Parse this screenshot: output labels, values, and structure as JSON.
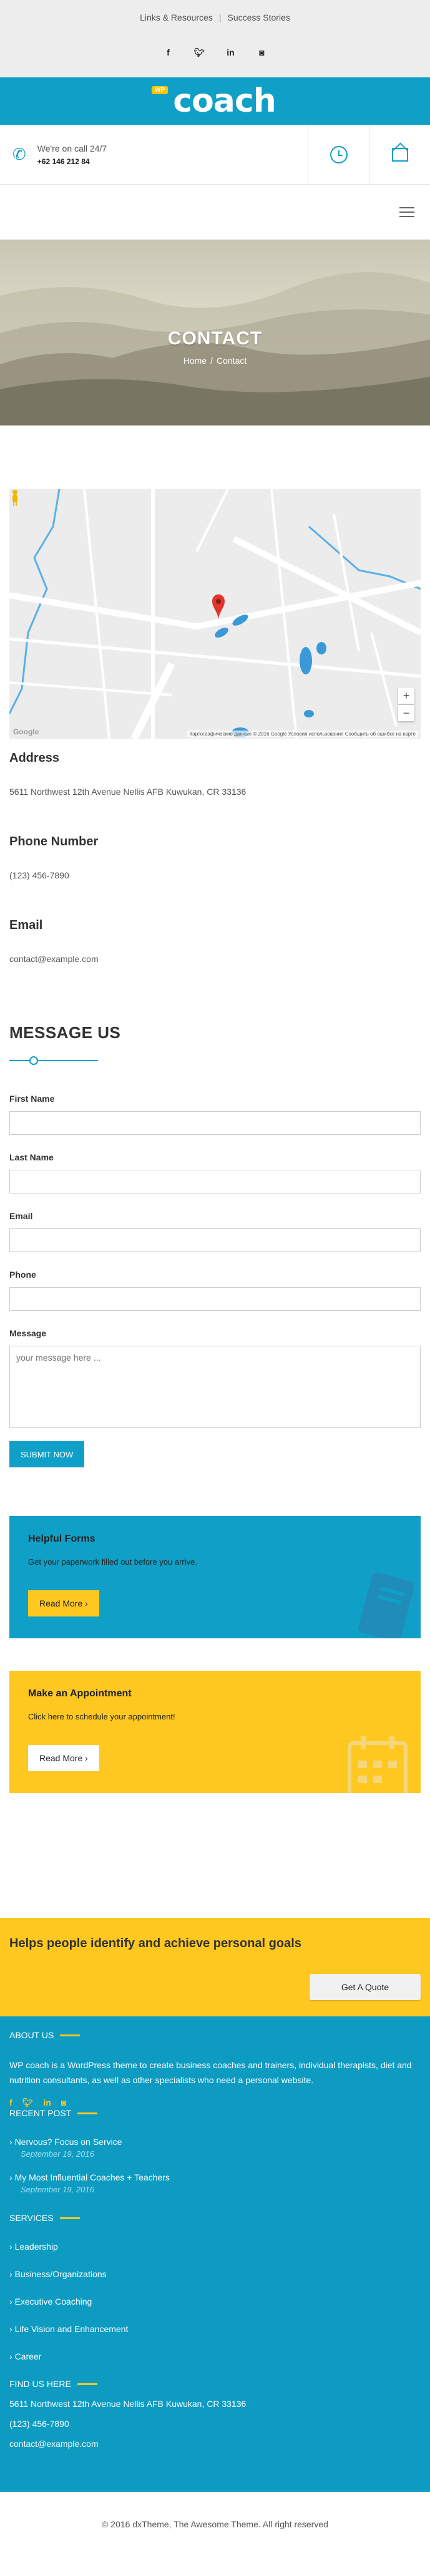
{
  "topbar": {
    "links": [
      "Links & Resources",
      "Success Stories"
    ],
    "social": [
      "f",
      "t",
      "in",
      "ig"
    ]
  },
  "logo": {
    "badge": "WP",
    "text": "coach"
  },
  "callbar": {
    "line1": "We're on call 24/7",
    "line2": "+62 146 212 84"
  },
  "hero": {
    "title": "CONTACT",
    "crumb_home": "Home",
    "crumb_sep": "/",
    "crumb_current": "Contact"
  },
  "map": {
    "google": "Google",
    "footer": "Картографические данные © 2016 Google    Условия использования    Сообщить об ошибке на карте",
    "zoom_in": "+",
    "zoom_out": "−"
  },
  "contact": {
    "address_label": "Address",
    "address": "5611 Northwest 12th Avenue Nellis AFB Kuwukan, CR 33136",
    "phone_label": "Phone Number",
    "phone": "(123) 456-7890",
    "email_label": "Email",
    "email": "contact@example.com"
  },
  "form": {
    "title": "MESSAGE US",
    "first_name": "First Name",
    "last_name": "Last Name",
    "email": "Email",
    "phone": "Phone",
    "message": "Message",
    "message_placeholder": "your message here ...",
    "submit": "SUBMIT NOW"
  },
  "promo_forms": {
    "title": "Helpful Forms",
    "text": "Get your paperwork filled out before you arrive.",
    "button": "Read More  ›"
  },
  "promo_appt": {
    "title": "Make an Appointment",
    "text": "Click here to schedule your appointment!",
    "button": "Read More  ›"
  },
  "goals": {
    "title": "Helps people identify and achieve personal goals",
    "button": "Get A Quote"
  },
  "footer": {
    "about_title": "ABOUT US",
    "about_text": "WP coach is a WordPress theme to create business coaches and trainers, individual therapists, diet and nutrition consultants, as well as other specialists who need a personal website.",
    "social": [
      "f",
      "t",
      "in",
      "ig"
    ],
    "recent_title": "RECENT POST",
    "posts": [
      {
        "title": "Nervous? Focus on Service",
        "date": "September 19, 2016"
      },
      {
        "title": "My Most Influential Coaches + Teachers",
        "date": "September 19, 2016"
      }
    ],
    "services_title": "SERVICES",
    "services": [
      "Leadership",
      "Business/Organizations",
      "Executive Coaching",
      "Life Vision and Enhancement",
      "Career"
    ],
    "find_title": "FIND US HERE",
    "address": "5611 Northwest 12th Avenue Nellis AFB Kuwukan, CR 33136",
    "phone": "(123) 456-7890",
    "email": "contact@example.com"
  },
  "copyright": "© 2016 dxTheme, The Awesome Theme. All right reserved",
  "colors": {
    "accent": "#10a0c7",
    "yellow": "#ffc820"
  }
}
